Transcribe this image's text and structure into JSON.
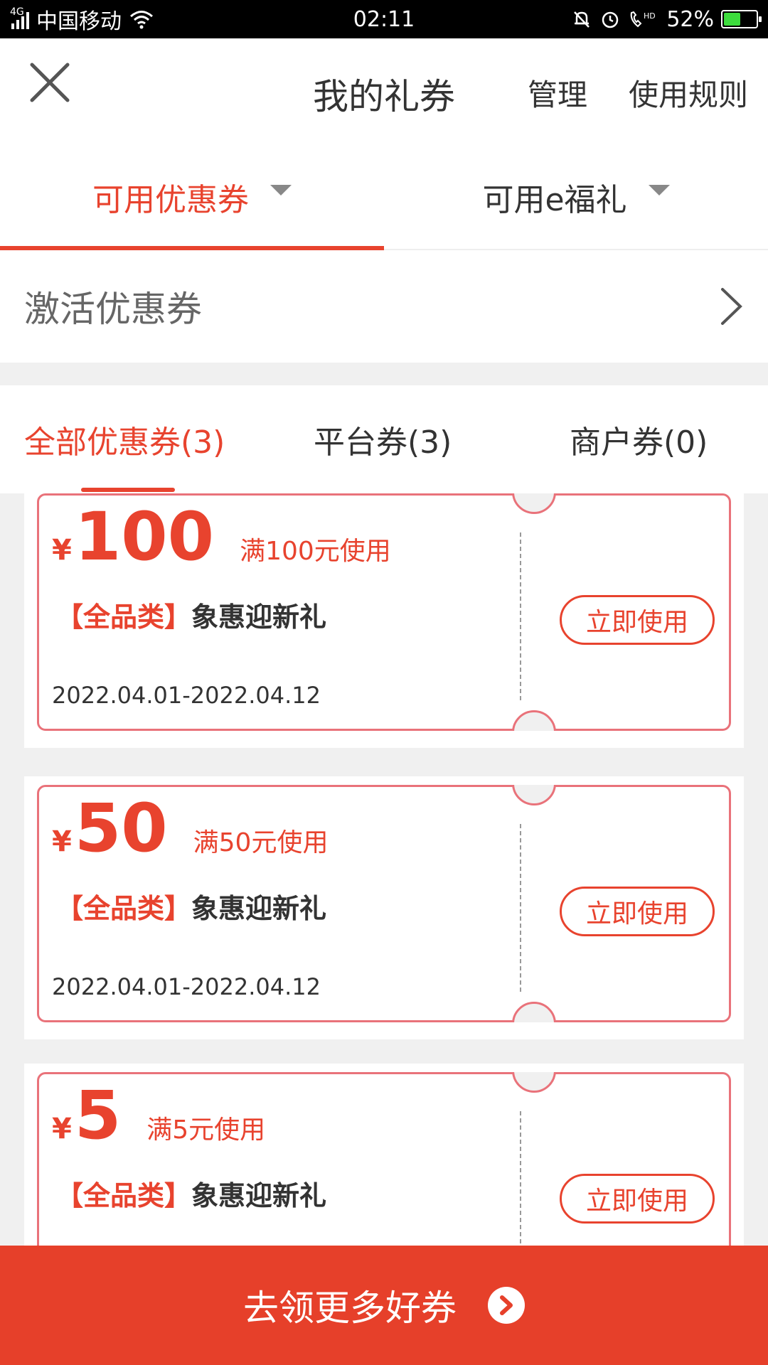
{
  "status_bar": {
    "network": "4G",
    "carrier": "中国移动",
    "time": "02:11",
    "battery": "52%",
    "battery_level": 0.52,
    "icons": [
      "signal-icon",
      "wifi-icon",
      "mute-bell-icon",
      "alarm-icon",
      "hd-call-icon",
      "battery-icon"
    ]
  },
  "header": {
    "title": "我的礼券",
    "manage": "管理",
    "rules": "使用规则"
  },
  "top_tabs": [
    {
      "label": "可用优惠券",
      "active": true
    },
    {
      "label": "可用e福礼",
      "active": false
    }
  ],
  "activate": {
    "label": "激活优惠券"
  },
  "sub_tabs": [
    {
      "label": "全部优惠券(3)",
      "active": true
    },
    {
      "label": "平台券(3)",
      "active": false
    },
    {
      "label": "商户券(0)",
      "active": false
    }
  ],
  "coupons": [
    {
      "currency": "¥",
      "amount": "100",
      "threshold": "满100元使用",
      "category": "【全品类】",
      "name": "象惠迎新礼",
      "date_range": "2022.04.01-2022.04.12",
      "action": "立即使用"
    },
    {
      "currency": "¥",
      "amount": "50",
      "threshold": "满50元使用",
      "category": "【全品类】",
      "name": "象惠迎新礼",
      "date_range": "2022.04.01-2022.04.12",
      "action": "立即使用"
    },
    {
      "currency": "¥",
      "amount": "5",
      "threshold": "满5元使用",
      "category": "【全品类】",
      "name": "象惠迎新礼",
      "date_range": "",
      "action": "立即使用"
    }
  ],
  "bottom": {
    "label": "去领更多好券"
  },
  "colors": {
    "accent": "#e8432e",
    "coupon_border": "#e9727a",
    "bottom_bar": "#e6402a",
    "background": "#f0f0f0"
  }
}
